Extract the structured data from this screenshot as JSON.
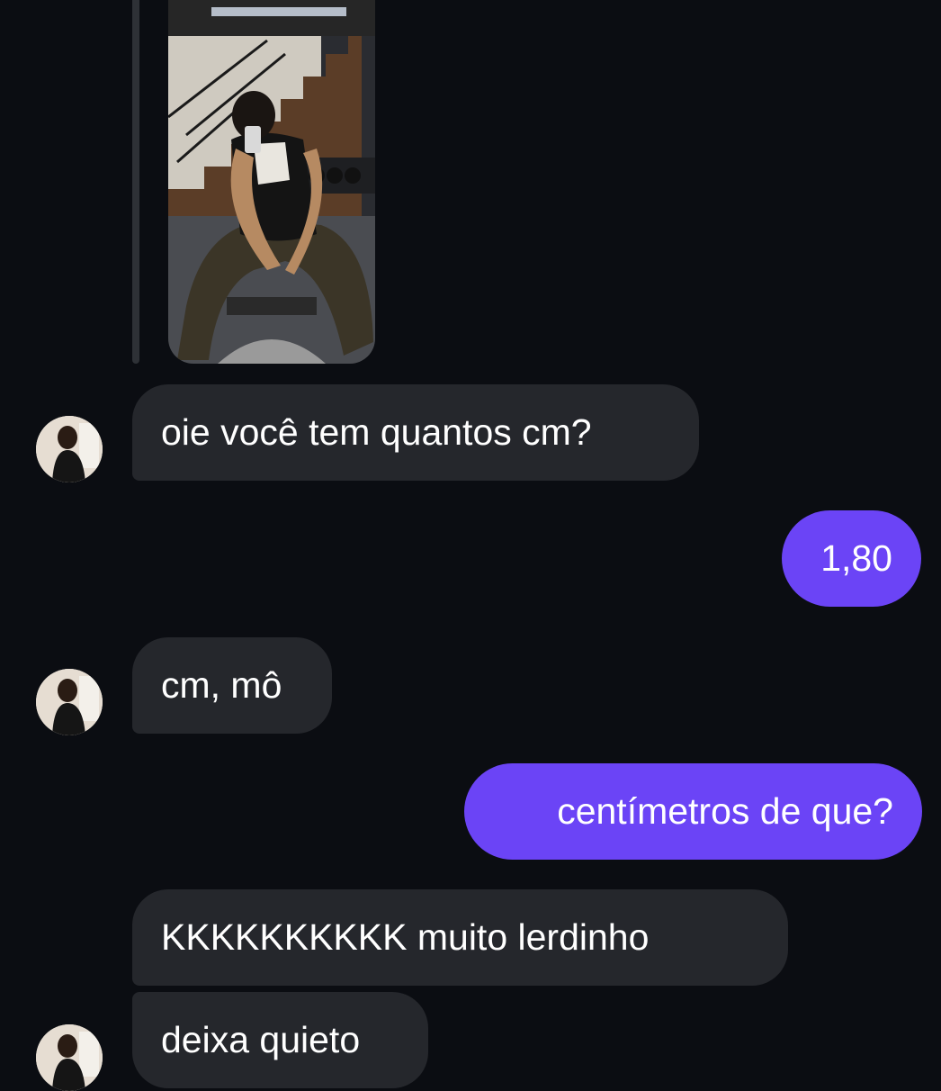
{
  "theme": {
    "background": "#0b0d12",
    "incoming_bubble": "#25272c",
    "outgoing_bubble": "#6b44f6",
    "text": "#ffffff"
  },
  "shared_media": {
    "type": "photo",
    "description_icon": "image-icon"
  },
  "messages": [
    {
      "from": "them",
      "text": "oie você tem quantos cm?"
    },
    {
      "from": "me",
      "text": "1,80"
    },
    {
      "from": "them",
      "text": "cm, mô"
    },
    {
      "from": "me",
      "text": "centímetros de que?"
    },
    {
      "from": "them",
      "text": "KKKKKKKKKK muito lerdinho"
    },
    {
      "from": "them",
      "text": "deixa quieto"
    }
  ]
}
